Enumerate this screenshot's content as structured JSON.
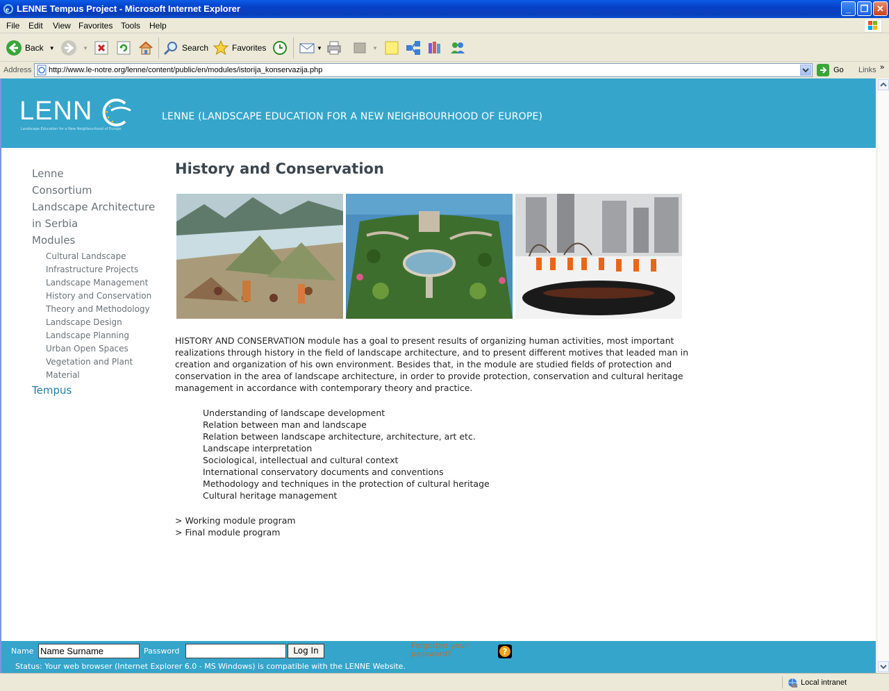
{
  "window": {
    "title": "LENNE Tempus Project - Microsoft Internet Explorer"
  },
  "menu": [
    "File",
    "Edit",
    "View",
    "Favorites",
    "Tools",
    "Help"
  ],
  "toolbar": {
    "back_label": "Back",
    "search_label": "Search",
    "favorites_label": "Favorites"
  },
  "address": {
    "label": "Address",
    "url": "http://www.le-notre.org/lenne/content/public/en/modules/istorija_konservazija.php",
    "go_label": "Go",
    "links_label": "Links"
  },
  "site": {
    "logo_text": "LENN",
    "logo_subtitle": "Landscape Education for a New Neighbourhood of Europe",
    "header_title": "LENNE (LANDSCAPE EDUCATION FOR A NEW NEIGHBOURHOOD OF EUROPE)"
  },
  "sidebar": {
    "main_top": [
      "Lenne",
      "Consortium",
      "Landscape Architecture",
      "in Serbia",
      "Modules"
    ],
    "modules": [
      "Cultural Landscape",
      "Infrastructure Projects",
      "Landscape Management",
      "History and Conservation",
      "Theory and Methodology",
      "Landscape Design",
      "Landscape Planning",
      "Urban Open Spaces",
      "Vegetation and Plant",
      "Material"
    ],
    "tempus": "Tempus"
  },
  "content": {
    "title": "History and Conservation",
    "intro": "HISTORY AND CONSERVATION module has a goal to present results of organizing human activities, most important realizations through history in the field of landscape architecture, and to present different motives that leaded man in creation and organization of his own environment. Besides that, in the module are studied fields of protection and conservation in the area of landscape architecture, in order to provide protection, conservation and cultural heritage management in accordance with contemporary theory and practice.",
    "topics": [
      "Understanding of landscape development",
      "Relation between man and landscape",
      "Relation between landscape architecture, architecture, art etc.",
      "Landscape interpretation",
      "Sociological, intellectual and cultural context",
      "International conservatory documents and conventions",
      "Methodology and techniques in the protection of cultural heritage",
      "Cultural heritage management"
    ],
    "links": [
      "> Working module program",
      "> Final module program"
    ]
  },
  "login": {
    "name_label": "Name",
    "name_value": "Name Surname",
    "password_label": "Password",
    "button_label": "Log In",
    "forgot_label": "Forgotten your password?",
    "status_text": "Status: Your web browser (Internet Explorer 6.0 - MS Windows) is compatible with the LENNE Website."
  },
  "statusbar": {
    "zone": "Local intranet"
  },
  "colors": {
    "header_bg": "#35a5cb",
    "nav_text": "#6b7278",
    "nav_active": "#1e7fa9",
    "forgot_link": "#ad7342"
  }
}
